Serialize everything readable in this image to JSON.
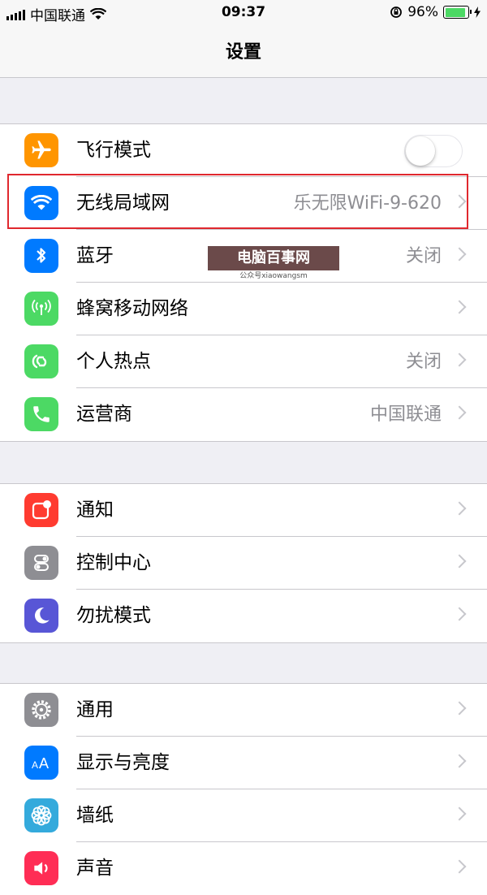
{
  "status_bar": {
    "carrier": "中国联通",
    "time": "09:37",
    "battery": "96%",
    "battery_level": 0.96
  },
  "nav": {
    "title": "设置"
  },
  "groups": [
    {
      "items": [
        {
          "label": "飞行模式",
          "icon": "airplane-icon",
          "color": "#ff9500",
          "toggle": false
        },
        {
          "label": "无线局域网",
          "icon": "wifi-icon",
          "color": "#007aff",
          "value": "乐无限WiFi-9-620",
          "highlighted": true
        },
        {
          "label": "蓝牙",
          "icon": "bluetooth-icon",
          "color": "#007aff",
          "value": "关闭"
        },
        {
          "label": "蜂窝移动网络",
          "icon": "cellular-icon",
          "color": "#4cd964",
          "value": ""
        },
        {
          "label": "个人热点",
          "icon": "hotspot-icon",
          "color": "#4cd964",
          "value": "关闭"
        },
        {
          "label": "运营商",
          "icon": "phone-icon",
          "color": "#4cd964",
          "value": "中国联通"
        }
      ]
    },
    {
      "items": [
        {
          "label": "通知",
          "icon": "notification-icon",
          "color": "#ff3b30"
        },
        {
          "label": "控制中心",
          "icon": "control-center-icon",
          "color": "#8e8e93"
        },
        {
          "label": "勿扰模式",
          "icon": "moon-icon",
          "color": "#5856d6"
        }
      ]
    },
    {
      "items": [
        {
          "label": "通用",
          "icon": "gear-icon",
          "color": "#8e8e93"
        },
        {
          "label": "显示与亮度",
          "icon": "display-icon",
          "color": "#007aff"
        },
        {
          "label": "墙纸",
          "icon": "wallpaper-icon",
          "color": "#34aadc"
        },
        {
          "label": "声音",
          "icon": "sound-icon",
          "color": "#ff2d55"
        }
      ]
    }
  ],
  "watermark": {
    "title": "电脑百事网",
    "subtitle": "公众号xiaowangsm"
  }
}
